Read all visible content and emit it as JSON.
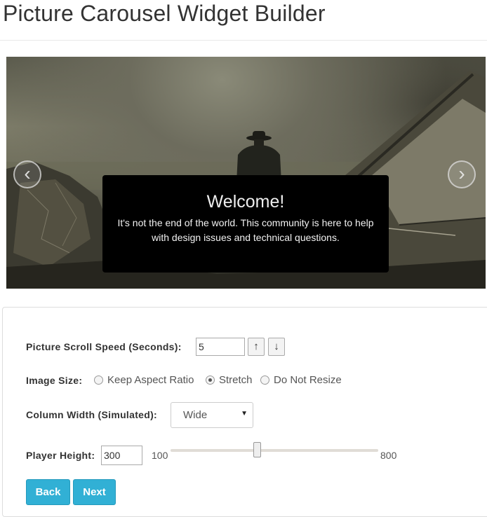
{
  "page": {
    "title": "Picture Carousel Widget Builder"
  },
  "carousel": {
    "prev_icon": "‹",
    "next_icon": "›",
    "caption_title": "Welcome!",
    "caption_text": "It's not the end of the world.  This community is here to help with design issues and technical questions."
  },
  "form": {
    "scroll_speed": {
      "label": "Picture Scroll Speed (Seconds):",
      "value": "5",
      "up_icon": "↑",
      "down_icon": "↓"
    },
    "image_size": {
      "label": "Image Size:",
      "options": [
        {
          "label": "Keep Aspect Ratio",
          "checked": false
        },
        {
          "label": "Stretch",
          "checked": true
        },
        {
          "label": "Do Not Resize",
          "checked": false
        }
      ]
    },
    "column_width": {
      "label": "Column Width (Simulated):",
      "selected": "Wide"
    },
    "player_height": {
      "label": "Player Height:",
      "value": "300",
      "min_label": "100",
      "max_label": "800",
      "min": 100,
      "max": 800,
      "current": 300
    },
    "buttons": {
      "back": "Back",
      "next": "Next"
    }
  },
  "colors": {
    "button": "#31b0d5",
    "caption_bg": "#000000"
  }
}
